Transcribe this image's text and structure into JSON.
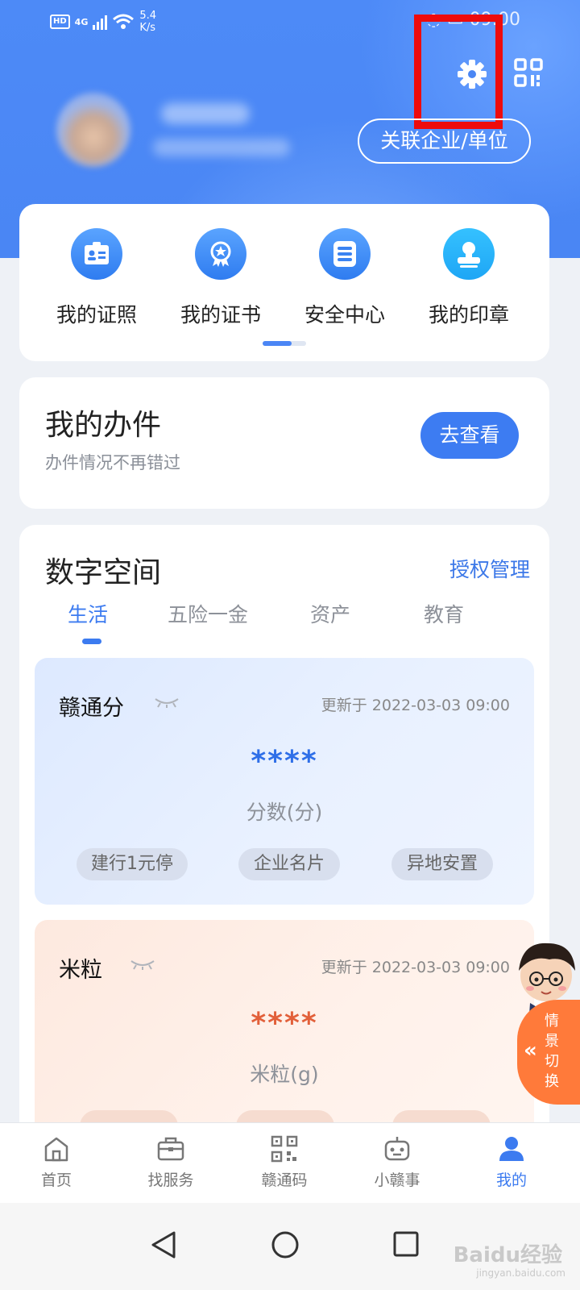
{
  "status_bar": {
    "hd": "HD",
    "network": "4G",
    "speed_value": "5.4",
    "speed_unit": "K/s",
    "right": "◌ ▭ 09:00"
  },
  "header": {
    "link_button": "关联企业/单位"
  },
  "quick_menu": [
    {
      "label": "我的证照",
      "icon": "id-card-icon"
    },
    {
      "label": "我的证书",
      "icon": "certificate-badge-icon"
    },
    {
      "label": "安全中心",
      "icon": "list-icon"
    },
    {
      "label": "我的印章",
      "icon": "stamp-icon"
    }
  ],
  "quick_pager": {
    "active_page": 1,
    "pages": 2
  },
  "work": {
    "title": "我的办件",
    "subtitle": "办件情况不再错过",
    "button": "去查看"
  },
  "digital_space": {
    "title": "数字空间",
    "auth": "授权管理",
    "tabs": [
      "生活",
      "五险一金",
      "资产",
      "教育"
    ],
    "active_tab": "生活",
    "cards": [
      {
        "name": "赣通分",
        "updated": "更新于 2022-03-03 09:00",
        "value": "****",
        "unit": "分数(分)",
        "chips": [
          "建行1元停",
          "企业名片",
          "异地安置"
        ],
        "accent": "#2f6fe8"
      },
      {
        "name": "米粒",
        "updated": "更新于 2022-03-03 09:00",
        "value": "****",
        "unit": "米粒(g)",
        "accent": "#e2603a"
      }
    ]
  },
  "floating": {
    "switch_label": "情景切换",
    "switch_arrow": "«"
  },
  "tabbar": [
    {
      "label": "首页",
      "icon": "home-icon"
    },
    {
      "label": "找服务",
      "icon": "briefcase-icon"
    },
    {
      "label": "赣通码",
      "icon": "qr-code-icon"
    },
    {
      "label": "小赣事",
      "icon": "robot-icon"
    },
    {
      "label": "我的",
      "icon": "user-icon"
    }
  ],
  "active_tab": "我的",
  "watermark": {
    "main": "Baidu经验",
    "sub": "jingyan.baidu.com"
  },
  "colors": {
    "primary": "#3c7bf0",
    "highlight": "#ee0b0b",
    "orange": "#ff7a3a"
  }
}
